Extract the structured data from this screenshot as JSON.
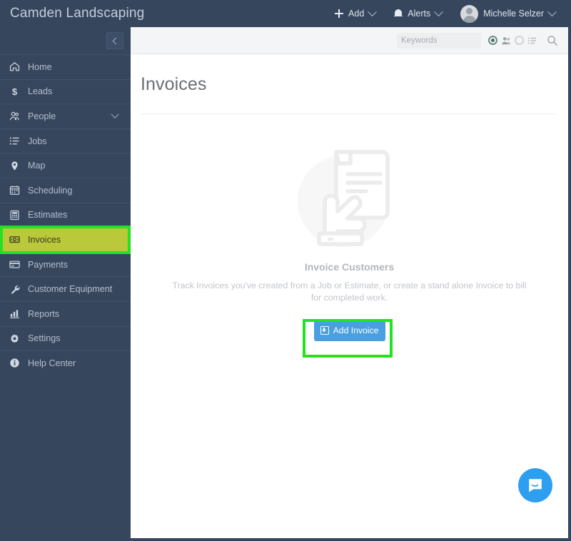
{
  "topbar": {
    "brand": "Camden Landscaping",
    "add_label": "Add",
    "alerts_label": "Alerts",
    "user_name": "Michelle Selzer"
  },
  "sidebar": {
    "collapse_icon": "chevron-left-icon",
    "items": [
      {
        "label": "Home",
        "icon": "home-icon",
        "active": false,
        "chevron": false
      },
      {
        "label": "Leads",
        "icon": "dollar-icon",
        "active": false,
        "chevron": false
      },
      {
        "label": "People",
        "icon": "people-icon",
        "active": false,
        "chevron": true
      },
      {
        "label": "Jobs",
        "icon": "list-icon",
        "active": false,
        "chevron": false
      },
      {
        "label": "Map",
        "icon": "map-pin-icon",
        "active": false,
        "chevron": false
      },
      {
        "label": "Scheduling",
        "icon": "calendar-icon",
        "active": false,
        "chevron": false
      },
      {
        "label": "Estimates",
        "icon": "calculator-icon",
        "active": false,
        "chevron": false
      },
      {
        "label": "Invoices",
        "icon": "invoice-icon",
        "active": true,
        "chevron": false
      },
      {
        "label": "Payments",
        "icon": "credit-card-icon",
        "active": false,
        "chevron": false
      },
      {
        "label": "Customer Equipment",
        "icon": "wrench-icon",
        "active": false,
        "chevron": false
      },
      {
        "label": "Reports",
        "icon": "bar-chart-icon",
        "active": false,
        "chevron": false
      },
      {
        "label": "Settings",
        "icon": "gear-icon",
        "active": false,
        "chevron": false
      },
      {
        "label": "Help Center",
        "icon": "info-icon",
        "active": false,
        "chevron": false
      }
    ]
  },
  "search": {
    "value": "",
    "placeholder": "Keywords",
    "option_people_selected": true,
    "option_list_selected": false
  },
  "main": {
    "page_title": "Invoices",
    "empty_title": "Invoice Customers",
    "empty_desc": "Track Invoices you've created from a Job or Estimate, or create a stand alone Invoice to bill for completed work.",
    "add_invoice_label": "Add Invoice"
  },
  "annotations": {
    "highlight_color": "#22e222",
    "highlighted_sidebar_item": "Invoices",
    "highlighted_button": "Add Invoice"
  },
  "chat": {
    "icon": "chat-bubble-icon"
  },
  "colors": {
    "sidebar_bg": "#36465d",
    "active_nav_bg": "#b9c93a",
    "primary_button": "#4a9fe0",
    "chat_fab": "#2d9ef0"
  }
}
